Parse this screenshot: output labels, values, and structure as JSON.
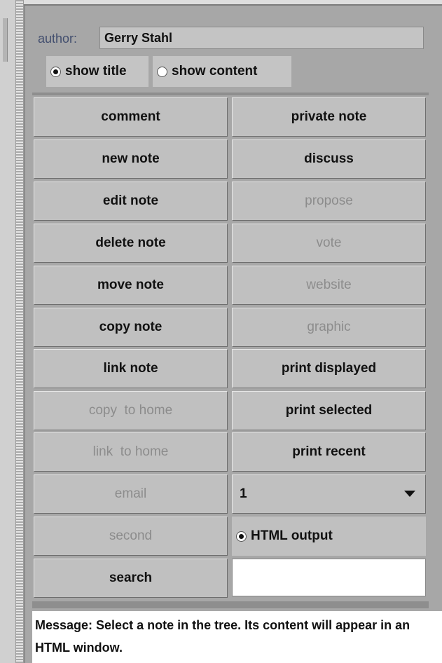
{
  "author": {
    "label": "author:",
    "value": "Gerry Stahl"
  },
  "view_options": {
    "show_title": "show title",
    "show_content": "show content",
    "selected": "show_title"
  },
  "buttons": {
    "comment": "comment",
    "private_note": "private note",
    "new_note": "new note",
    "discuss": "discuss",
    "edit_note": "edit note",
    "propose": "propose",
    "delete_note": "delete note",
    "vote": "vote",
    "move_note": "move note",
    "website": "website",
    "copy_note": "copy note",
    "graphic": "graphic",
    "link_note": "link note",
    "print_displayed": "print displayed",
    "copy_to_home": "copy  to home",
    "print_selected": "print selected",
    "link_to_home": "link  to home",
    "print_recent": "print recent",
    "email": "email",
    "second": "second",
    "search": "search"
  },
  "recent_count": {
    "selected": "1"
  },
  "html_output": {
    "label": "HTML output",
    "checked": true
  },
  "search_field": {
    "value": ""
  },
  "message": {
    "text": "Message: Select a note in the tree. Its content will appear in an HTML window."
  },
  "colors": {
    "panel": "#a7a7a7",
    "button": "#c0c0c0",
    "disabled_text": "#8c8c8c",
    "author_label": "#424e6e"
  }
}
